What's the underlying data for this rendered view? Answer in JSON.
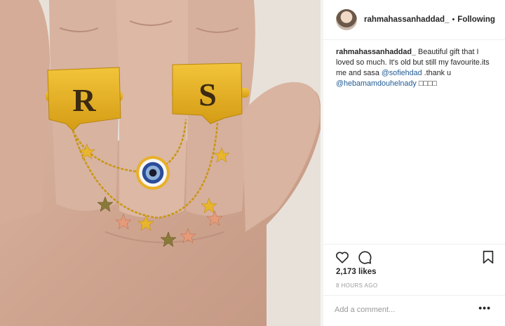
{
  "header": {
    "username": "rahmahassanhaddad_",
    "separator": "•",
    "follow_label": "Following"
  },
  "caption": {
    "username": "rahmahassanhaddad_",
    "text_1": "Beautiful gift that I loved so much. It's old but still my favourite.its me and sasa",
    "mention_1": "@sofiehdad",
    "text_2": ".thank u",
    "mention_2": "@hebamamdouhelnady",
    "emoji": "□□□□"
  },
  "photo": {
    "ring_letter_left": "R",
    "ring_letter_right": "S"
  },
  "actions": {
    "like_icon": "heart-outline-icon",
    "comment_icon": "comment-bubble-icon",
    "save_icon": "bookmark-icon"
  },
  "stats": {
    "likes": "2,173 likes",
    "posted": "8 HOURS AGO"
  },
  "comment_box": {
    "placeholder": "Add a comment...",
    "more_label": "•••"
  },
  "colors": {
    "link": "#1f5a92",
    "gold": "#e3b021",
    "border": "#dbdbdb"
  }
}
